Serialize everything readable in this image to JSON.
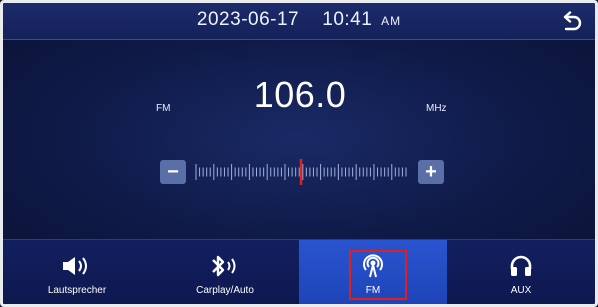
{
  "status": {
    "date": "2023-06-17",
    "time": "10:41",
    "ampm": "AM"
  },
  "radio": {
    "band": "FM",
    "frequency": "106.0",
    "unit": "MHz",
    "tuner_position": 0.5
  },
  "tuner": {
    "minus_label": "−",
    "plus_label": "+"
  },
  "tabs": [
    {
      "label": "Lautsprecher",
      "icon": "speaker-icon",
      "active": false
    },
    {
      "label": "Carplay/Auto",
      "icon": "bluetooth-icon",
      "active": false
    },
    {
      "label": "FM",
      "icon": "radio-antenna-icon",
      "active": true
    },
    {
      "label": "AUX",
      "icon": "headphones-icon",
      "active": false
    }
  ],
  "colors": {
    "background": "#0f1a48",
    "active_tab": "#2a55d0",
    "needle": "#e0201c",
    "highlight_box": "#e0201c"
  }
}
